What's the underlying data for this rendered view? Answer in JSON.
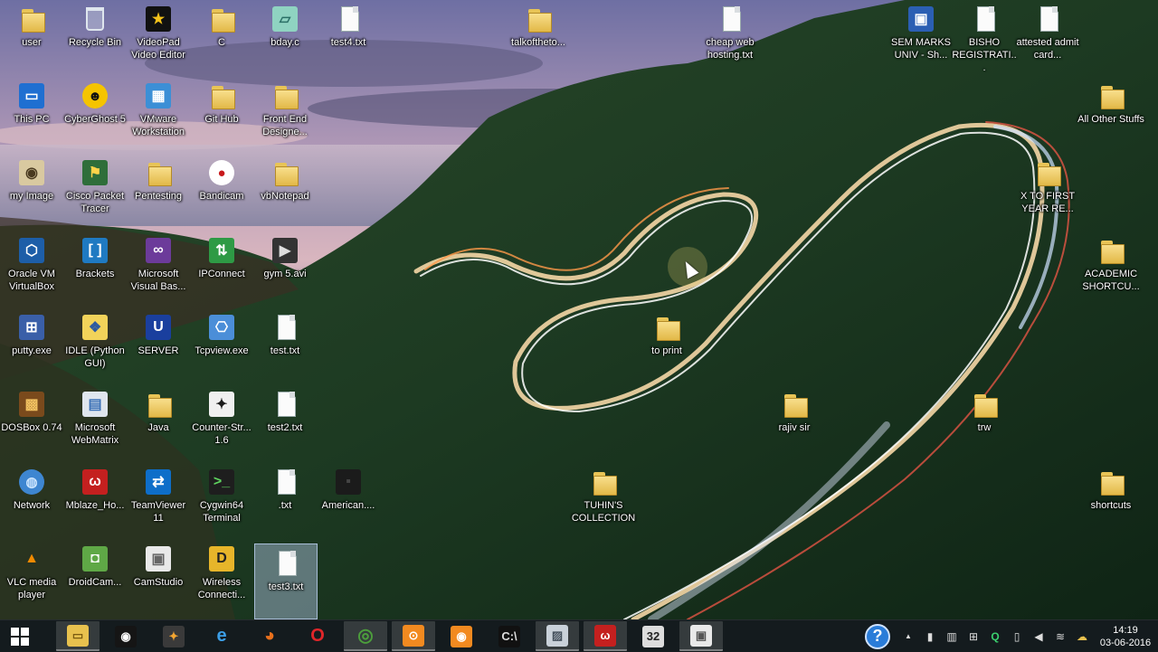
{
  "desktop": {
    "icons": [
      {
        "label": "user",
        "type": "folder"
      },
      {
        "label": "Recycle Bin",
        "type": "recycle"
      },
      {
        "label": "VideoPad Video Editor",
        "type": "app",
        "glyph": "★",
        "bg": "#111111",
        "fg": "#f4c21b"
      },
      {
        "label": "C",
        "type": "folder"
      },
      {
        "label": "bday.c",
        "type": "app",
        "glyph": "▱",
        "bg": "#8fd3c1",
        "fg": "#2a6f66"
      },
      {
        "label": "test4.txt",
        "type": "file"
      },
      {
        "label": "talkofthetо...",
        "type": "folder"
      },
      {
        "label": "cheap web hosting.txt",
        "type": "file"
      },
      {
        "label": "SEM MARKS UNIV - Sh...",
        "type": "app",
        "glyph": "▣",
        "bg": "#2b5fb3",
        "fg": "#ffffff"
      },
      {
        "label": "BISHO REGISTRATI...",
        "type": "file"
      },
      {
        "label": "attested admit card...",
        "type": "file"
      },
      {
        "label": "This PC",
        "type": "app",
        "glyph": "▭",
        "bg": "#1f6fd1",
        "fg": "#ffffff"
      },
      {
        "label": "CyberGhost 5",
        "type": "app",
        "glyph": "☻",
        "bg": "#f5c400",
        "fg": "#111111",
        "round": true
      },
      {
        "label": "VMware Workstation",
        "type": "app",
        "glyph": "▦",
        "bg": "#3c8fd6",
        "fg": "#ffffff"
      },
      {
        "label": "Git Hub",
        "type": "folder"
      },
      {
        "label": "Front End Designe...",
        "type": "folder"
      },
      {
        "label": "All Other Stuffs",
        "type": "folder"
      },
      {
        "label": "my Image",
        "type": "app",
        "glyph": "◉",
        "bg": "#d9c9a0",
        "fg": "#4a3a20"
      },
      {
        "label": "Cisco Packet Tracer",
        "type": "app",
        "glyph": "⚑",
        "bg": "#2f6e3a",
        "fg": "#ffd34a"
      },
      {
        "label": "Pentesting",
        "type": "folder"
      },
      {
        "label": "Bandicam",
        "type": "app",
        "glyph": "●",
        "bg": "#ffffff",
        "fg": "#c8191b",
        "round": true
      },
      {
        "label": "vbNotepad",
        "type": "folder"
      },
      {
        "label": "X TO FIRST YEAR RE...",
        "type": "folder"
      },
      {
        "label": "Oracle VM VirtualBox",
        "type": "app",
        "glyph": "⬡",
        "bg": "#1d5ea8",
        "fg": "#ffffff"
      },
      {
        "label": "Brackets",
        "type": "app",
        "glyph": "[ ]",
        "bg": "#1f7ac2",
        "fg": "#ffffff"
      },
      {
        "label": "Microsoft Visual Bas...",
        "type": "app",
        "glyph": "∞",
        "bg": "#6c3b9a",
        "fg": "#ffffff"
      },
      {
        "label": "IPConnect",
        "type": "app",
        "glyph": "⇅",
        "bg": "#2e9a45",
        "fg": "#ffffff"
      },
      {
        "label": "gym 5.avi",
        "type": "app",
        "glyph": "▶",
        "bg": "#333333",
        "fg": "#dddddd"
      },
      {
        "label": "ACADEMIC SHORTCU...",
        "type": "folder"
      },
      {
        "label": "putty.exe",
        "type": "app",
        "glyph": "⊞",
        "bg": "#3a5fa8",
        "fg": "#ffffff"
      },
      {
        "label": "IDLE (Python GUI)",
        "type": "app",
        "glyph": "❖",
        "bg": "#f2d35a",
        "fg": "#2d5aa0"
      },
      {
        "label": "SERVER",
        "type": "app",
        "glyph": "U",
        "bg": "#1a3f9e",
        "fg": "#ffffff"
      },
      {
        "label": "Tcpview.exe",
        "type": "app",
        "glyph": "⎔",
        "bg": "#4b8ed8",
        "fg": "#ffffff"
      },
      {
        "label": "test.txt",
        "type": "file"
      },
      {
        "label": "to print",
        "type": "folder"
      },
      {
        "label": "DOSBox 0.74",
        "type": "app",
        "glyph": "▩",
        "bg": "#7a4a1c",
        "fg": "#f0c060"
      },
      {
        "label": "Microsoft WebMatrix",
        "type": "app",
        "glyph": "▤",
        "bg": "#dfe6ee",
        "fg": "#3a70b6"
      },
      {
        "label": "Java",
        "type": "folder"
      },
      {
        "label": "Counter-Str... 1.6",
        "type": "app",
        "glyph": "✦",
        "bg": "#f0f0f0",
        "fg": "#1a1a1a"
      },
      {
        "label": "test2.txt",
        "type": "file"
      },
      {
        "label": "rajiv sir",
        "type": "folder"
      },
      {
        "label": "trw",
        "type": "folder"
      },
      {
        "label": "Network",
        "type": "app",
        "glyph": "◍",
        "bg": "#3e86d1",
        "fg": "#cde6ff",
        "round": true
      },
      {
        "label": "Mblaze_Ho...",
        "type": "app",
        "glyph": "ω",
        "bg": "#c4201f",
        "fg": "#ffffff"
      },
      {
        "label": "TeamViewer 11",
        "type": "app",
        "glyph": "⇄",
        "bg": "#0e6ec9",
        "fg": "#ffffff"
      },
      {
        "label": "Cygwin64 Terminal",
        "type": "app",
        "glyph": ">_",
        "bg": "#1e1e1e",
        "fg": "#5fd35f"
      },
      {
        "label": ".txt",
        "type": "file"
      },
      {
        "label": "American....",
        "type": "app",
        "glyph": "▪",
        "bg": "#1b1b1b",
        "fg": "#444444"
      },
      {
        "label": "TUHIN'S COLLECTION",
        "type": "folder"
      },
      {
        "label": "shortcuts",
        "type": "folder"
      },
      {
        "label": "VLC media player",
        "type": "app",
        "glyph": "▲",
        "bg": "transparent",
        "fg": "#f18a00"
      },
      {
        "label": "DroidCam...",
        "type": "app",
        "glyph": "◘",
        "bg": "#5fa846",
        "fg": "#ffffff"
      },
      {
        "label": "CamStudio",
        "type": "app",
        "glyph": "▣",
        "bg": "#e9e9e9",
        "fg": "#666666"
      },
      {
        "label": "Wireless Connecti...",
        "type": "app",
        "glyph": "D",
        "bg": "#e7b52a",
        "fg": "#222222"
      },
      {
        "label": "test3.txt",
        "type": "file",
        "selected": true
      }
    ]
  },
  "taskbar": {
    "start_label": "Start",
    "apps": [
      {
        "name": "file-explorer",
        "glyph": "▭",
        "bg": "#e8c14e",
        "fg": "#7a5b10",
        "open": true
      },
      {
        "name": "bandicam",
        "glyph": "◉",
        "bg": "#151515",
        "fg": "#ffffff",
        "open": false
      },
      {
        "name": "paint",
        "glyph": "✦",
        "bg": "#3a3a3a",
        "fg": "#f3a531",
        "open": false
      },
      {
        "name": "internet-explorer",
        "glyph": "e",
        "bg": "transparent",
        "fg": "#3c9ee6",
        "open": false
      },
      {
        "name": "firefox",
        "glyph": "◕",
        "bg": "transparent",
        "fg": "#e8701c",
        "open": false
      },
      {
        "name": "opera",
        "glyph": "O",
        "bg": "transparent",
        "fg": "#e0262a",
        "open": false
      },
      {
        "name": "chrome",
        "glyph": "◎",
        "bg": "transparent",
        "fg": "#4c9e3c",
        "open": true
      },
      {
        "name": "bandicam-orange",
        "glyph": "⊙",
        "bg": "#f28a20",
        "fg": "#ffffff",
        "open": true
      },
      {
        "name": "camera",
        "glyph": "◉",
        "bg": "#f28a20",
        "fg": "#ffffff",
        "open": false
      },
      {
        "name": "cmd",
        "glyph": "C:\\",
        "bg": "#111111",
        "fg": "#dddddd",
        "open": false
      },
      {
        "name": "image-viewer",
        "glyph": "▨",
        "bg": "#c9d1d9",
        "fg": "#44505c",
        "open": true
      },
      {
        "name": "mblaze",
        "glyph": "ω",
        "bg": "#c4201f",
        "fg": "#ffffff",
        "open": true
      },
      {
        "name": "cygwin",
        "glyph": "32",
        "bg": "#dddddd",
        "fg": "#222222",
        "open": false
      },
      {
        "name": "camstudio",
        "glyph": "▣",
        "bg": "#e9e9e9",
        "fg": "#555555",
        "open": true
      }
    ],
    "tray": {
      "help_glyph": "?",
      "icons": [
        {
          "name": "show-hidden-icons",
          "glyph": "▲"
        },
        {
          "name": "phone",
          "glyph": "▮"
        },
        {
          "name": "network-bars",
          "glyph": "▥"
        },
        {
          "name": "windows-flag",
          "glyph": "⊞"
        },
        {
          "name": "q-app",
          "glyph": "Q"
        },
        {
          "name": "battery",
          "glyph": "▯"
        },
        {
          "name": "volume",
          "glyph": "◀"
        },
        {
          "name": "wifi",
          "glyph": "≋"
        },
        {
          "name": "cloud",
          "glyph": "☁"
        }
      ],
      "time": "14:19",
      "date": "03-06-2016"
    }
  }
}
